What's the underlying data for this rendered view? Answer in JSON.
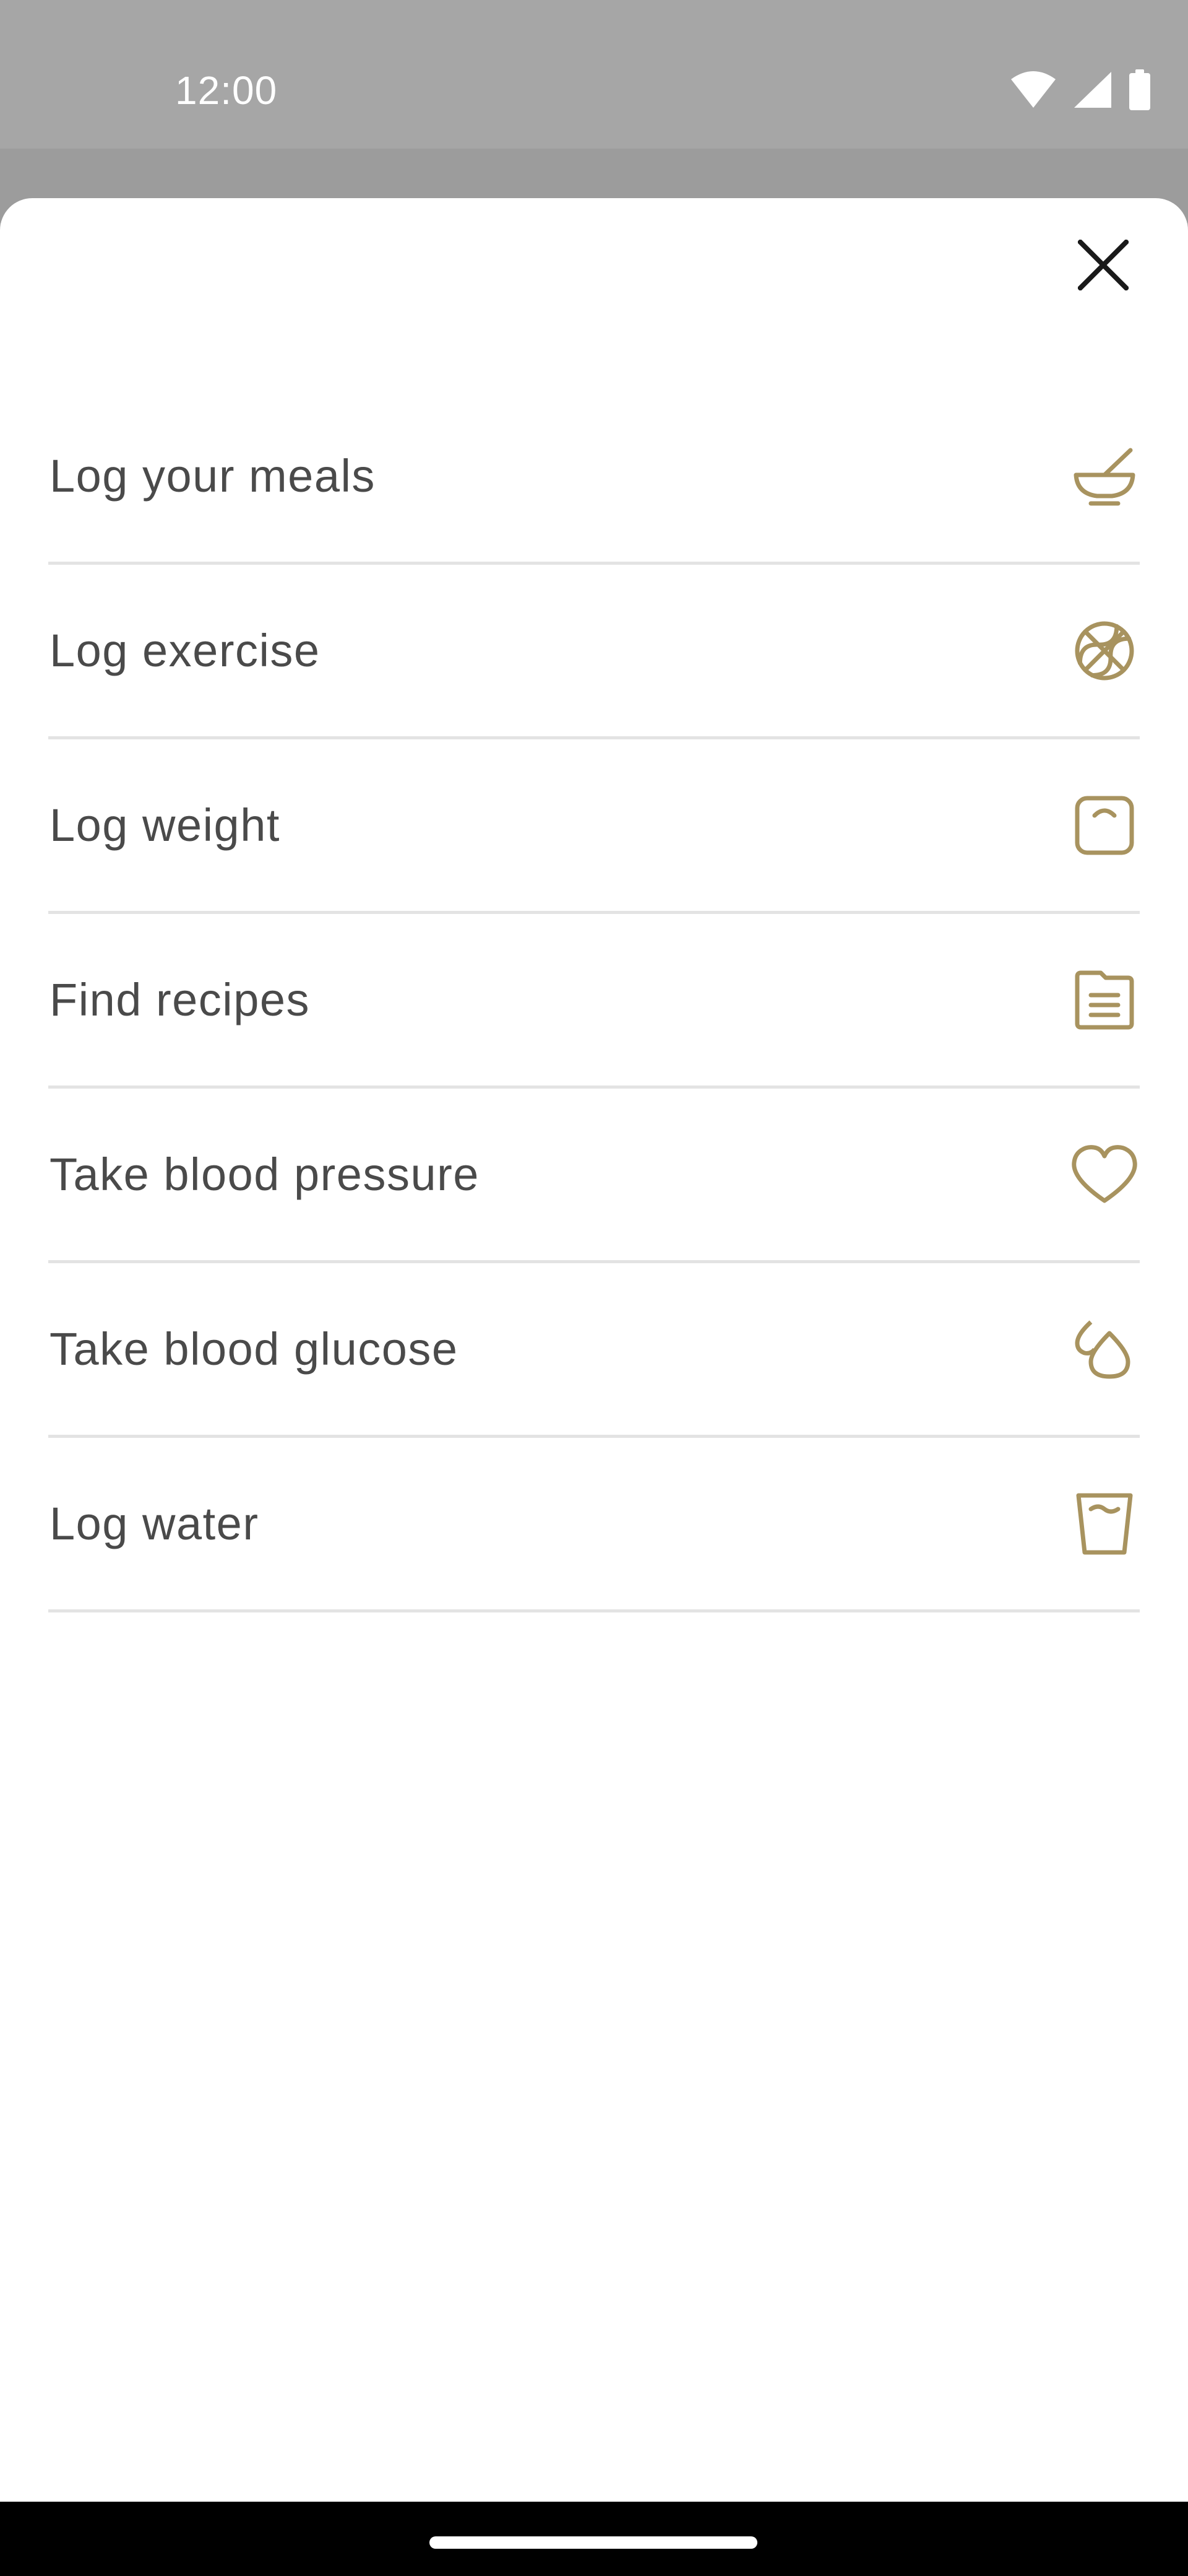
{
  "status_bar": {
    "time": "12:00",
    "icons": [
      "wifi-icon",
      "signal-icon",
      "battery-icon"
    ]
  },
  "sheet": {
    "close_icon": "close-icon",
    "items": [
      {
        "label": "Log your meals",
        "icon": "bowl-icon"
      },
      {
        "label": "Log exercise",
        "icon": "basketball-icon"
      },
      {
        "label": "Log weight",
        "icon": "scale-icon"
      },
      {
        "label": "Find recipes",
        "icon": "recipe-icon"
      },
      {
        "label": "Take blood pressure",
        "icon": "heart-icon"
      },
      {
        "label": "Take blood glucose",
        "icon": "drops-icon"
      },
      {
        "label": "Log water",
        "icon": "water-glass-icon"
      }
    ]
  },
  "colors": {
    "accent_icon": "#a8935f",
    "label_text": "#4a4a4a",
    "divider": "#e3e3e3",
    "status_bar_bg": "#a6a6a6"
  }
}
